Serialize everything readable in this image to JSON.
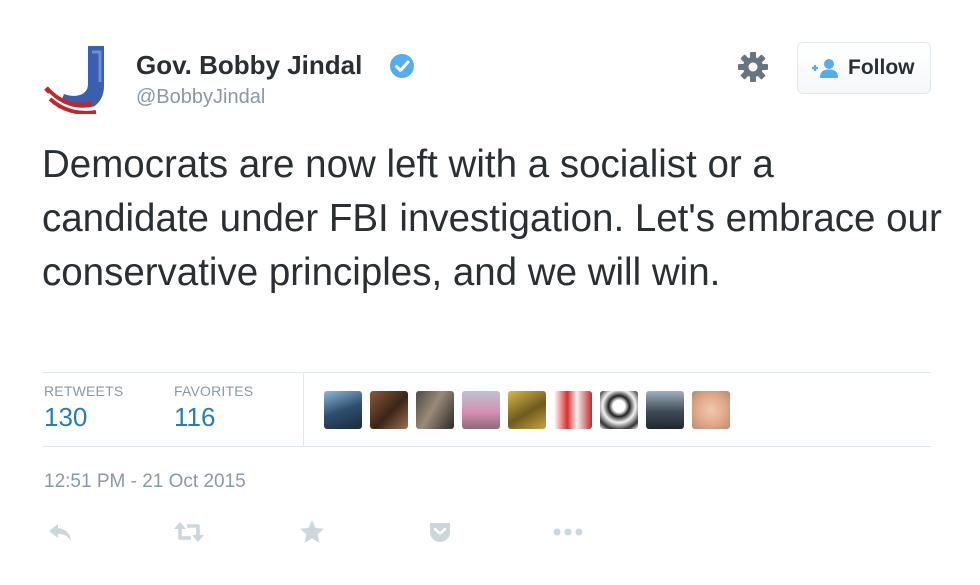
{
  "author": {
    "name": "Gov. Bobby Jindal",
    "handle": "@BobbyJindal",
    "avatar_icon": "jindal-j-logo",
    "verified_icon": "verified-badge-icon"
  },
  "follow_button": {
    "label": "Follow",
    "icon": "add-user-icon"
  },
  "settings_icon": "gear-icon",
  "tweet_text": "Democrats are now left with a socialist or a candidate under FBI investigation. Let's embrace our conservative principles, and we will win.",
  "stats": {
    "retweets_label": "RETWEETS",
    "retweets_count": "130",
    "favorites_label": "FAVORITES",
    "favorites_count": "116"
  },
  "timestamp": "12:51 PM - 21 Oct 2015",
  "actions": [
    "reply-icon",
    "retweet-icon",
    "favorite-star-icon",
    "pocket-icon",
    "more-dots-icon"
  ],
  "colors": {
    "text": "#292f33",
    "muted": "#8899a6",
    "link": "#2b7bb9",
    "verified": "#55acee",
    "border": "#e1e8ed",
    "action_icon": "#ccd6dd"
  }
}
